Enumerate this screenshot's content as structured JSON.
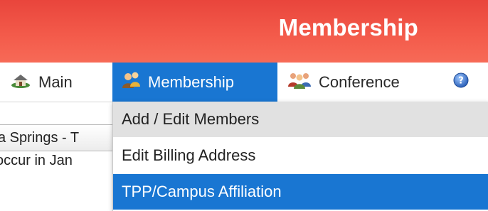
{
  "header": {
    "title": "Membership",
    "color": "#f04c40"
  },
  "nav": {
    "items": [
      {
        "label": "Main",
        "icon": "house-icon"
      },
      {
        "label": "Membership",
        "icon": "people-icon",
        "active": true
      },
      {
        "label": "Conference",
        "icon": "group-icon"
      },
      {
        "label": "",
        "icon": "help-icon"
      }
    ],
    "active_color": "#1976d2"
  },
  "dropdown": {
    "items": [
      {
        "label": "Add / Edit Members",
        "state": "hover"
      },
      {
        "label": "Edit Billing Address",
        "state": "normal"
      },
      {
        "label": "TPP/Campus Affiliation",
        "state": "selected"
      }
    ]
  },
  "background": {
    "header_text": "a Springs - T",
    "row_text": "occur in Jan"
  }
}
